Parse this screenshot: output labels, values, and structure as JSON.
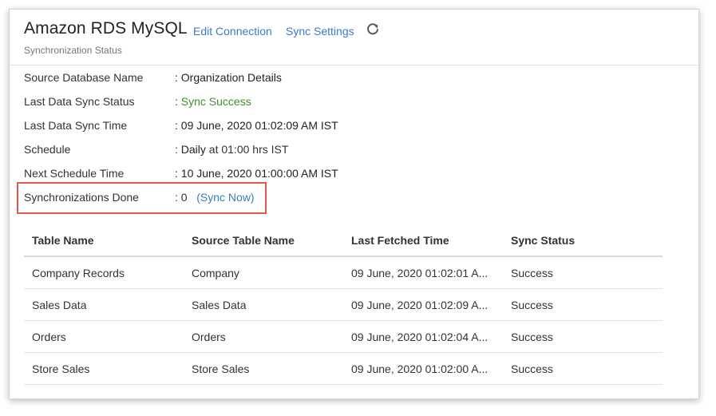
{
  "header": {
    "title": "Amazon RDS MySQL",
    "edit_connection": "Edit Connection",
    "sync_settings": "Sync Settings",
    "subtitle": "Synchronization Status"
  },
  "info": {
    "source_db_label": "Source Database Name",
    "source_db_value": ": Organization Details",
    "last_status_label": "Last Data Sync Status",
    "last_status_prefix": ": ",
    "last_status_value": "Sync Success",
    "last_time_label": "Last Data Sync Time",
    "last_time_value": ": 09 June, 2020 01:02:09 AM IST",
    "schedule_label": "Schedule",
    "schedule_prefix": ": ",
    "schedule_bold": "Daily",
    "schedule_rest": " at 01:00 hrs IST",
    "next_label": "Next Schedule Time",
    "next_value": ": 10 June, 2020 01:00:00 AM IST",
    "done_label": "Synchronizations Done",
    "done_value": ": 0",
    "sync_now": "(Sync Now)"
  },
  "table": {
    "headers": [
      "Table Name",
      "Source Table Name",
      "Last Fetched Time",
      "Sync Status"
    ],
    "rows": [
      [
        "Company Records",
        "Company",
        "09 June, 2020 01:02:01 A...",
        "Success"
      ],
      [
        "Sales Data",
        "Sales Data",
        "09 June, 2020 01:02:09 A...",
        "Success"
      ],
      [
        "Orders",
        "Orders",
        "09 June, 2020 01:02:04 A...",
        "Success"
      ],
      [
        "Store Sales",
        "Store Sales",
        "09 June, 2020 01:02:00 A...",
        "Success"
      ]
    ]
  },
  "colors": {
    "link": "#3a7bc8",
    "success": "#3f8f2c",
    "highlight": "#e2574c"
  },
  "icons": {
    "refresh": "refresh-icon"
  }
}
